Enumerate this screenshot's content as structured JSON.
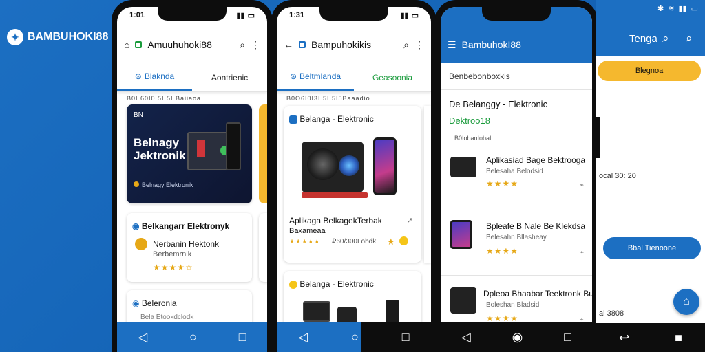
{
  "brand": {
    "name": "BAMBUHOKI88"
  },
  "phone1": {
    "time": "1:01",
    "title": "Amuuhuhoki88",
    "tabs": [
      "Blaknda",
      "Aontrienic"
    ],
    "subline": "B0I 60I0 5I 5I  Baiiaoa",
    "banner": {
      "title": "Belnagy\nJektronik",
      "sub": "Belnagy Elektronik"
    },
    "card1": {
      "title": "Belkangarr Elektronyk",
      "line1": "Nerbanin Hektonk",
      "line2": "Berbemrnik",
      "stars": "★★★★☆"
    },
    "card2": {
      "title": "Beleronia",
      "line1": "Bela Etookdclodk"
    }
  },
  "phone2": {
    "time": "1:31",
    "title": "Bampuhokikis",
    "tabs": [
      "Beltmlanda",
      "Geasoonia"
    ],
    "subline": "B0O6I0I3I 5I  5I5Baaadio",
    "card1": {
      "title": "Belanga - Elektronic",
      "caption": "Aplikaga BelkagekTerbak",
      "sub": "Baxameaa",
      "meta": "₽60/300Lobdk",
      "stars": "★★★★★"
    },
    "card2": {
      "title": "Belanga - Elektronic"
    }
  },
  "phone3": {
    "title": "BambuhokI88",
    "header": "Benbebonboxkis",
    "heading": "De Belanggy - Elektronic",
    "sub": "Dektroo18",
    "small": "B0IobanIobaI",
    "items": [
      {
        "title": "Aplikasiad Bage Bektrooga",
        "sub": "Belesaha Belodsid",
        "stars": "★★★★"
      },
      {
        "title": "Bpleafe B Nale Be Klekdsa",
        "sub": "Belesahn Bllasheay",
        "stars": "★★★★"
      },
      {
        "title": "Dpleoa Bhaabar Teektronk Bug",
        "sub": "Boleshan Bladsid",
        "stars": "★★★★"
      }
    ]
  },
  "phone4": {
    "title": "Tenga",
    "pill": "Blegnoa",
    "meta1": "ocal 30: 20",
    "button": "Bbal Tienoone",
    "meta2": "al 3808"
  },
  "colors": {
    "primary": "#1c6fc2",
    "accent": "#f5b82e",
    "green": "#1a9b3c"
  }
}
